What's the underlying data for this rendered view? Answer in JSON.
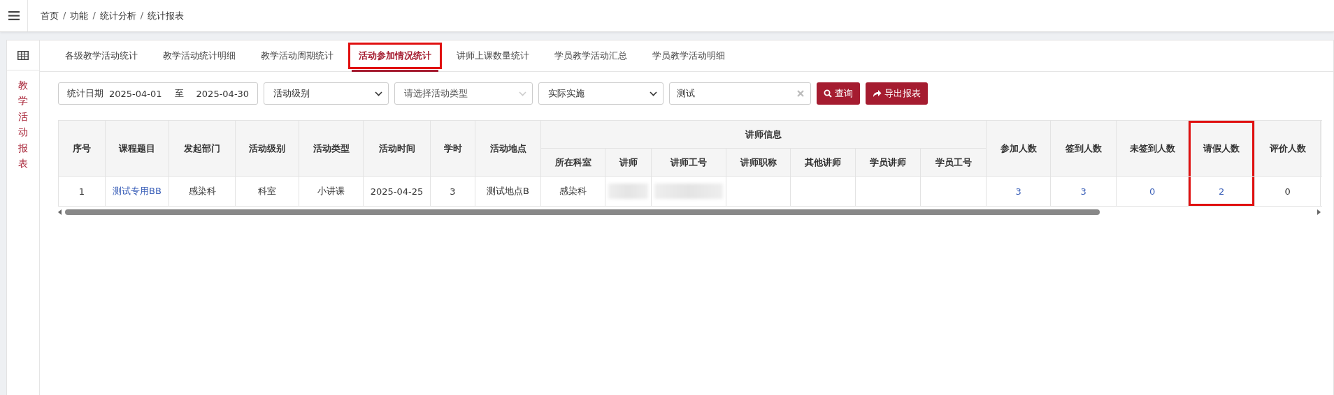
{
  "breadcrumb": [
    "首页",
    "功能",
    "统计分析",
    "统计报表"
  ],
  "breadcrumb_separator": "/",
  "sidebar": {
    "title": "教学活动报表"
  },
  "tabs": [
    {
      "label": "各级教学活动统计",
      "selected": false,
      "annotated": false
    },
    {
      "label": "教学活动统计明细",
      "selected": false,
      "annotated": false
    },
    {
      "label": "教学活动周期统计",
      "selected": false,
      "annotated": false
    },
    {
      "label": "活动参加情况统计",
      "selected": true,
      "annotated": true
    },
    {
      "label": "讲师上课数量统计",
      "selected": false,
      "annotated": false
    },
    {
      "label": "学员教学活动汇总",
      "selected": false,
      "annotated": false
    },
    {
      "label": "学员教学活动明细",
      "selected": false,
      "annotated": false
    }
  ],
  "filters": {
    "date_label": "统计日期",
    "date_from": "2025-04-01",
    "date_sep": "至",
    "date_to": "2025-04-30",
    "level_select": "活动级别",
    "type_select": {
      "placeholder": "请选择活动类型"
    },
    "status_select": "实际实施",
    "keyword": "测试",
    "buttons": [
      {
        "label": "查询",
        "kind": "search"
      },
      {
        "label": "导出报表",
        "kind": "export"
      }
    ]
  },
  "table": {
    "columns": [
      {
        "label": "序号"
      },
      {
        "label": "课程题目"
      },
      {
        "label": "发起部门"
      },
      {
        "label": "活动级别"
      },
      {
        "label": "活动类型"
      },
      {
        "label": "活动时间"
      },
      {
        "label": "学时"
      },
      {
        "label": "活动地点"
      },
      {
        "label": "讲师信息",
        "children": [
          {
            "label": "所在科室"
          },
          {
            "label": "讲师"
          },
          {
            "label": "讲师工号"
          },
          {
            "label": "讲师职称"
          },
          {
            "label": "其他讲师"
          },
          {
            "label": "学员讲师"
          },
          {
            "label": "学员工号"
          }
        ]
      },
      {
        "label": "参加人数"
      },
      {
        "label": "签到人数"
      },
      {
        "label": "未签到人数"
      },
      {
        "label": "请假人数",
        "highlighted": true
      },
      {
        "label": "评价人数"
      }
    ],
    "rows": [
      [
        {
          "kind": "text",
          "text": "1"
        },
        {
          "kind": "link",
          "text": "测试专用BB"
        },
        {
          "kind": "text",
          "text": "感染科"
        },
        {
          "kind": "text",
          "text": "科室"
        },
        {
          "kind": "text",
          "text": "小讲课"
        },
        {
          "kind": "text",
          "text": "2025-04-25"
        },
        {
          "kind": "text",
          "text": "3"
        },
        {
          "kind": "text",
          "text": "测试地点B"
        },
        {
          "kind": "text",
          "text": "感染科"
        },
        {
          "kind": "blurred"
        },
        {
          "kind": "blurred"
        },
        {
          "kind": "empty"
        },
        {
          "kind": "empty"
        },
        {
          "kind": "empty"
        },
        {
          "kind": "empty"
        },
        {
          "kind": "link",
          "text": "3"
        },
        {
          "kind": "link",
          "text": "3"
        },
        {
          "kind": "link",
          "text": "0"
        },
        {
          "kind": "link",
          "text": "2"
        },
        {
          "kind": "text",
          "text": "0"
        }
      ]
    ]
  }
}
